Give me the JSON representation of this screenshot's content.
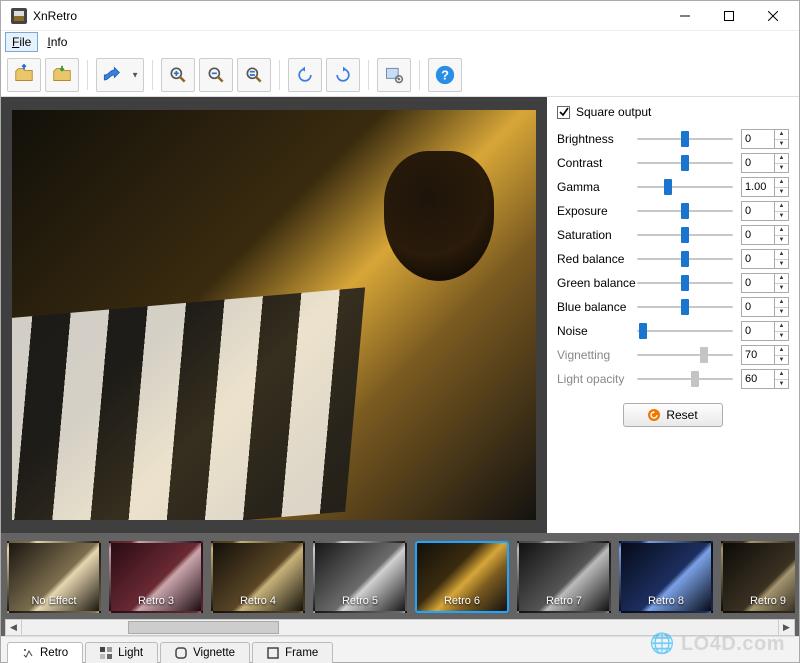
{
  "window": {
    "title": "XnRetro"
  },
  "menu": {
    "file": "File",
    "info": "Info"
  },
  "controls": {
    "square_output": {
      "label": "Square output",
      "checked": true
    },
    "sliders": [
      {
        "key": "brightness",
        "label": "Brightness",
        "value": "0",
        "pos": 50,
        "dimmed": false
      },
      {
        "key": "contrast",
        "label": "Contrast",
        "value": "0",
        "pos": 50,
        "dimmed": false
      },
      {
        "key": "gamma",
        "label": "Gamma",
        "value": "1.00",
        "pos": 32,
        "dimmed": false
      },
      {
        "key": "exposure",
        "label": "Exposure",
        "value": "0",
        "pos": 50,
        "dimmed": false
      },
      {
        "key": "saturation",
        "label": "Saturation",
        "value": "0",
        "pos": 50,
        "dimmed": false
      },
      {
        "key": "red_balance",
        "label": "Red balance",
        "value": "0",
        "pos": 50,
        "dimmed": false
      },
      {
        "key": "green_balance",
        "label": "Green balance",
        "value": "0",
        "pos": 50,
        "dimmed": false
      },
      {
        "key": "blue_balance",
        "label": "Blue balance",
        "value": "0",
        "pos": 50,
        "dimmed": false
      },
      {
        "key": "noise",
        "label": "Noise",
        "value": "0",
        "pos": 6,
        "dimmed": false
      },
      {
        "key": "vignetting",
        "label": "Vignetting",
        "value": "70",
        "pos": 70,
        "dimmed": true
      },
      {
        "key": "light_opacity",
        "label": "Light opacity",
        "value": "60",
        "pos": 60,
        "dimmed": true
      }
    ],
    "reset": "Reset"
  },
  "effects": [
    {
      "label": "No Effect",
      "selected": false,
      "swatch": "sc-noeffect"
    },
    {
      "label": "Retro 3",
      "selected": false,
      "swatch": "sc-retro3"
    },
    {
      "label": "Retro 4",
      "selected": false,
      "swatch": "sc-retro4"
    },
    {
      "label": "Retro 5",
      "selected": false,
      "swatch": "sc-retro5"
    },
    {
      "label": "Retro 6",
      "selected": true,
      "swatch": "sc-retro6"
    },
    {
      "label": "Retro 7",
      "selected": false,
      "swatch": "sc-retro7"
    },
    {
      "label": "Retro 8",
      "selected": false,
      "swatch": "sc-retro8"
    },
    {
      "label": "Retro 9",
      "selected": false,
      "swatch": "sc-retro9"
    }
  ],
  "tabs": [
    {
      "label": "Retro",
      "active": true
    },
    {
      "label": "Light",
      "active": false
    },
    {
      "label": "Vignette",
      "active": false
    },
    {
      "label": "Frame",
      "active": false
    }
  ],
  "watermark": "LO4D.com"
}
